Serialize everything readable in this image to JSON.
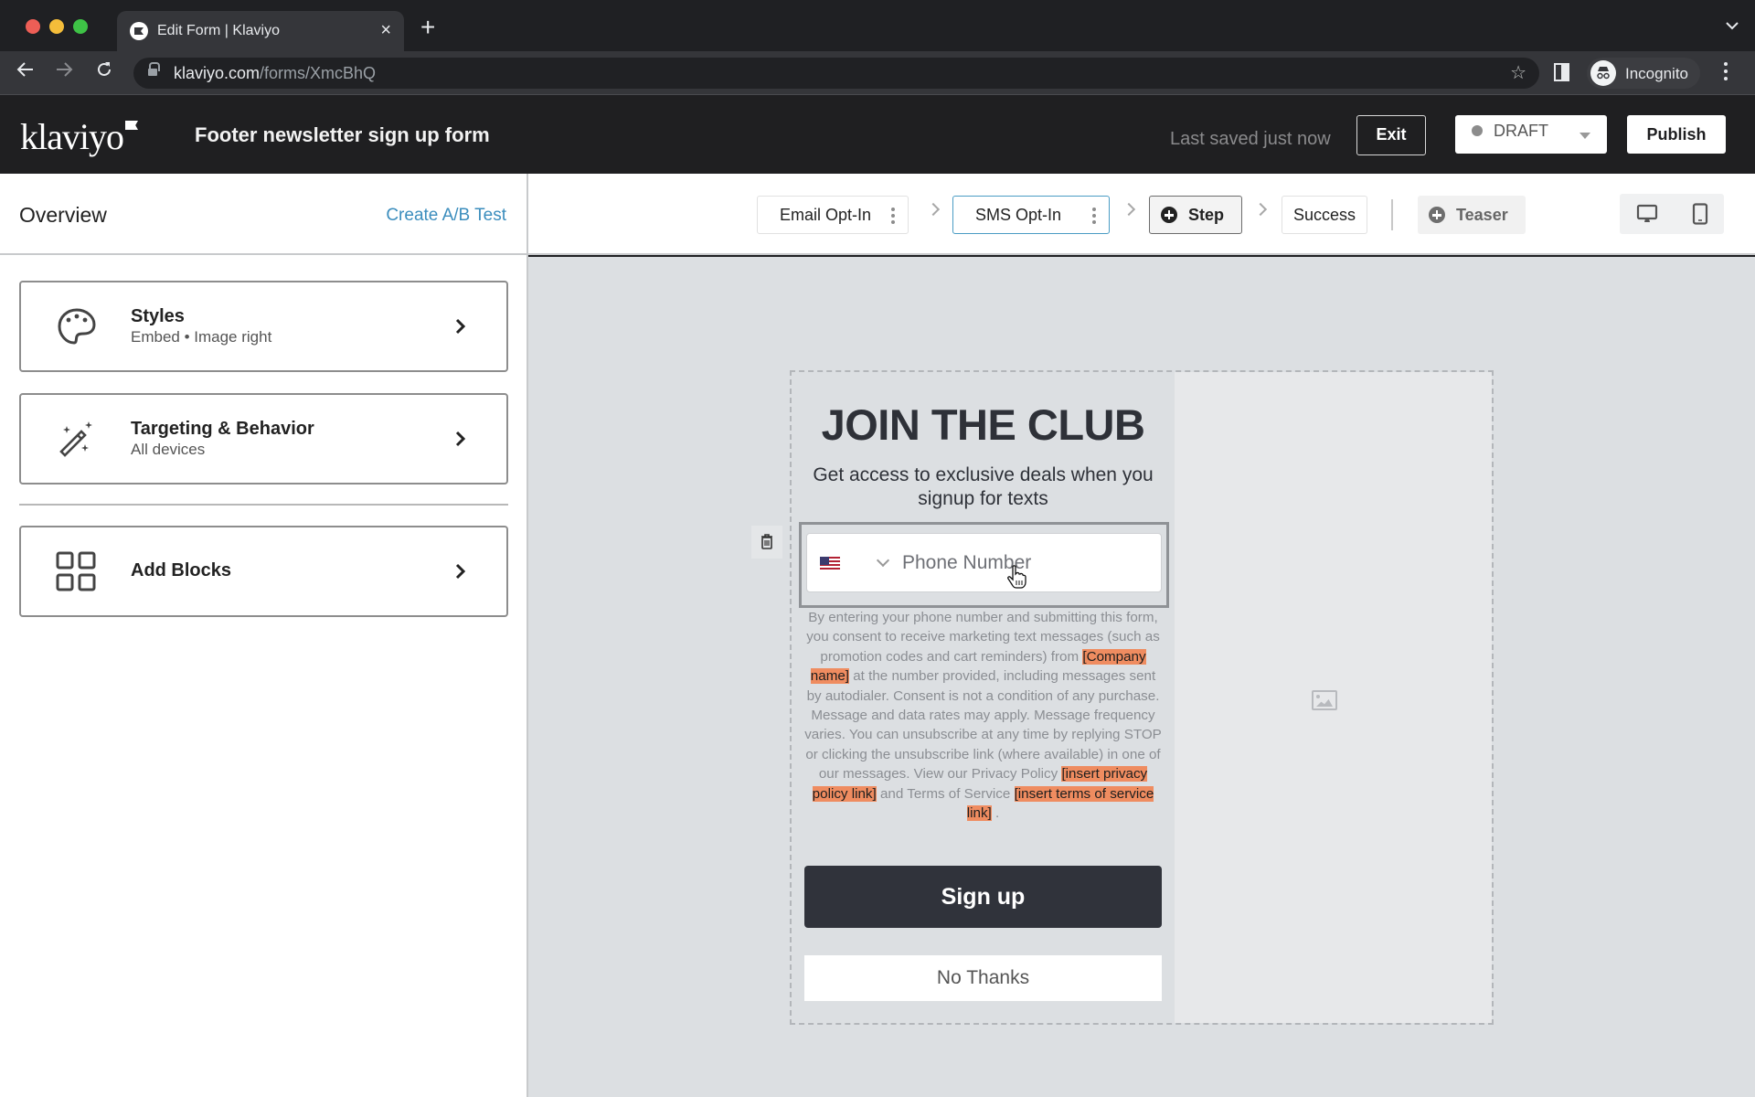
{
  "browser": {
    "tab_title": "Edit Form | Klaviyo",
    "url_domain": "klaviyo.com",
    "url_path": "/forms/XmcBhQ",
    "profile_label": "Incognito"
  },
  "header": {
    "logo_text": "klaviyo",
    "form_title": "Footer newsletter sign up form",
    "last_saved": "Last saved just now",
    "exit_label": "Exit",
    "status_value": "DRAFT",
    "publish_label": "Publish"
  },
  "sidebar": {
    "title": "Overview",
    "ab_test_link": "Create A/B Test",
    "cards": [
      {
        "icon": "palette-icon",
        "title": "Styles",
        "subtitle": "Embed • Image right"
      },
      {
        "icon": "magic-wand-icon",
        "title": "Targeting & Behavior",
        "subtitle": "All devices"
      },
      {
        "icon": "blocks-grid-icon",
        "title": "Add Blocks",
        "subtitle": ""
      }
    ]
  },
  "steps": {
    "items": [
      {
        "label": "Email Opt-In",
        "selected": false
      },
      {
        "label": "SMS Opt-In",
        "selected": true
      }
    ],
    "add_step_label": "Step",
    "success_label": "Success",
    "teaser_label": "Teaser",
    "device_options": [
      "desktop",
      "mobile"
    ],
    "accent_color": "#4a9cc4"
  },
  "form": {
    "headline": "JOIN THE CLUB",
    "subheadline": "Get access to exclusive deals when you signup for texts",
    "phone_country": "US",
    "phone_placeholder": "Phone Number",
    "consent": {
      "part1": "By entering your phone number and submitting this form, you consent to receive marketing text messages (such as promotion codes and cart reminders) from ",
      "company_placeholder": "[Company name]",
      "part2": " at the number provided, including messages sent by autodialer. Consent is not a condition of any purchase. Message and data rates may apply. Message frequency varies. You can unsubscribe at any time by replying STOP or clicking the unsubscribe link (where available) in one of our messages. View our Privacy Policy ",
      "privacy_placeholder": "[insert privacy policy link]",
      "part3": " and Terms of Service ",
      "terms_placeholder": "[insert terms of service link]",
      "part4": " ."
    },
    "signup_label": "Sign up",
    "no_thanks_label": "No Thanks",
    "placeholder_highlight_color": "#ef8c60",
    "button_color": "#30333b"
  }
}
